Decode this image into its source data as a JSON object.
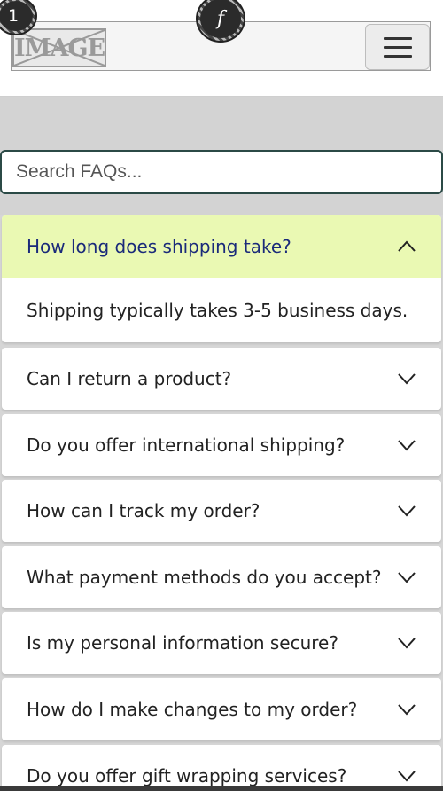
{
  "header": {
    "logo_text": "IMAGE",
    "menu_button_icon": "hamburger-menu-icon"
  },
  "badges": {
    "number_label": "1",
    "f_label": "f"
  },
  "search": {
    "placeholder": "Search FAQs...",
    "value": ""
  },
  "faq": {
    "items": [
      {
        "question": "How long does shipping take?",
        "answer": "Shipping typically takes 3-5 business days.",
        "expanded": true,
        "icon": "chevron-up-icon"
      },
      {
        "question": "Can I return a product?",
        "expanded": false,
        "icon": "chevron-down-icon"
      },
      {
        "question": "Do you offer international shipping?",
        "expanded": false,
        "icon": "chevron-down-icon"
      },
      {
        "question": "How can I track my order?",
        "expanded": false,
        "icon": "chevron-down-icon"
      },
      {
        "question": "What payment methods do you accept?",
        "expanded": false,
        "icon": "chevron-down-icon"
      },
      {
        "question": "Is my personal information secure?",
        "expanded": false,
        "icon": "chevron-down-icon"
      },
      {
        "question": "How do I make changes to my order?",
        "expanded": false,
        "icon": "chevron-down-icon"
      },
      {
        "question": "Do you offer gift wrapping services?",
        "expanded": false,
        "icon": "chevron-down-icon"
      }
    ]
  },
  "colors": {
    "active_question_bg": "#eaf9b3",
    "active_question_text": "#1a2a7a",
    "search_border": "#2b4a46",
    "grey_band": "#d3d3d3"
  }
}
